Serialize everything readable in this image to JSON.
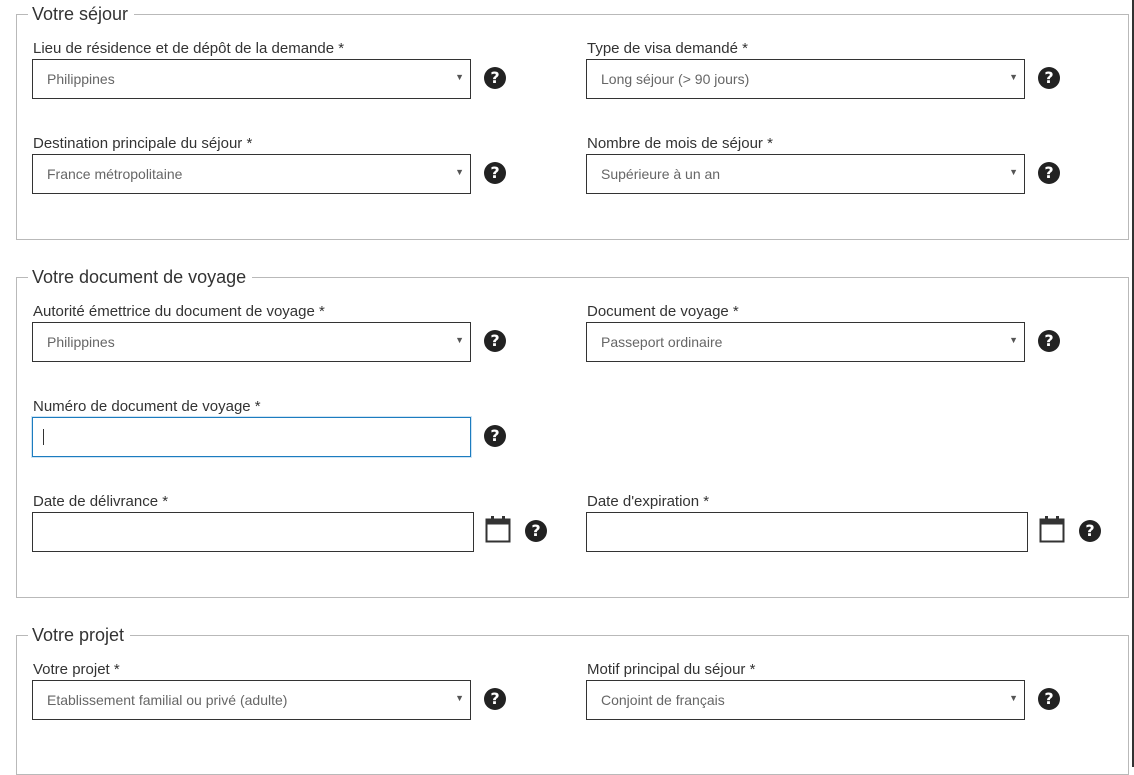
{
  "sejour": {
    "legend": "Votre séjour",
    "residence": {
      "label": "Lieu de résidence et de dépôt de la demande *",
      "value": "Philippines"
    },
    "visa_type": {
      "label": "Type de visa demandé *",
      "value": "Long séjour (> 90 jours)"
    },
    "destination": {
      "label": "Destination principale du séjour *",
      "value": "France métropolitaine"
    },
    "months": {
      "label": "Nombre de mois de séjour *",
      "value": "Supérieure à un an"
    }
  },
  "document": {
    "legend": "Votre document de voyage",
    "authority": {
      "label": "Autorité émettrice du document de voyage *",
      "value": "Philippines"
    },
    "doc_type": {
      "label": "Document de voyage *",
      "value": "Passeport ordinaire"
    },
    "number": {
      "label": "Numéro de document de voyage *",
      "value": ""
    },
    "issue_date": {
      "label": "Date de délivrance *",
      "value": ""
    },
    "expiry_date": {
      "label": "Date d'expiration *",
      "value": ""
    }
  },
  "projet": {
    "legend": "Votre projet",
    "project": {
      "label": "Votre projet *",
      "value": "Etablissement familial ou privé (adulte)"
    },
    "motive": {
      "label": "Motif principal du séjour *",
      "value": "Conjoint de français"
    }
  },
  "icons": {
    "help": "question-circle-icon",
    "calendar": "calendar-icon",
    "dropdown": "caret-down-icon"
  },
  "colors": {
    "focus_border": "#1c7cbf",
    "field_border": "#333333",
    "fieldset_border": "#b9b9b9"
  }
}
